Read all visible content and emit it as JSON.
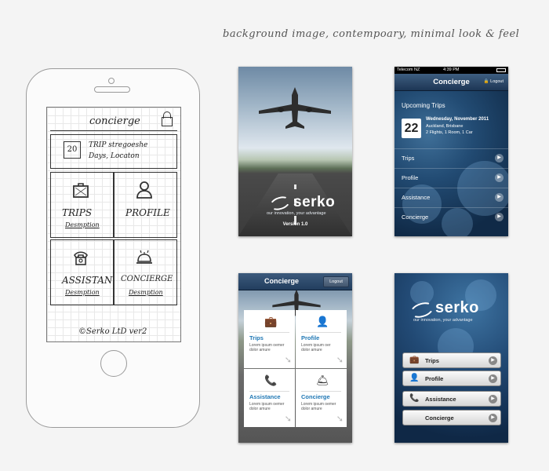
{
  "caption": "background image, contempoary, minimal look & feel",
  "sketch": {
    "title": "concierge",
    "trip_date": "20",
    "trip_line1": "TRIP stregoeshe",
    "trip_line2": "Days, Locaton",
    "tiles": [
      {
        "label": "TRIPS",
        "sub": "Desmption"
      },
      {
        "label": "PROFILE",
        "sub": ""
      },
      {
        "label": "ASSISTAN",
        "sub": "Desmption"
      },
      {
        "label": "CONCIERGE",
        "sub": "Desmption"
      }
    ],
    "footer": "©Serko LtD   ver2"
  },
  "splash": {
    "brand": "serko",
    "tagline": "our innovation, your advantage",
    "version": "Version 1.0"
  },
  "list_screen": {
    "carrier": "Telecom NZ",
    "time": "4:39 PM",
    "title": "Concierge",
    "logout": "Logout",
    "section": "Upcoming Trips",
    "date_day": "22",
    "trip_date": "Wednesday, November 2011",
    "trip_places": "Auckland, Brisbane",
    "trip_items": "2 Flights, 1 Room, 1 Car",
    "rows": [
      "Trips",
      "Profile",
      "Assistance",
      "Concierge"
    ]
  },
  "tiles_screen": {
    "title": "Concierge",
    "logout": "Logout",
    "tiles": [
      {
        "label": "Trips",
        "desc1": "Lorem ipsum oemer",
        "desc2": "dolor amure"
      },
      {
        "label": "Profile",
        "desc1": "Lorem ipsum oer",
        "desc2": "dolor amure"
      },
      {
        "label": "Assistance",
        "desc1": "Lorem ipsum oemer",
        "desc2": "dolor amure"
      },
      {
        "label": "Concierge",
        "desc1": "Lorem ipsum oemer",
        "desc2": "dolor amure"
      }
    ]
  },
  "menu_screen": {
    "brand": "serko",
    "tagline": "our innovation, your advantage",
    "buttons": [
      "Trips",
      "Profile",
      "Assistance",
      "Concierge"
    ]
  },
  "icons": {
    "trips": "suitcase-icon",
    "profile": "person-icon",
    "assistance": "phone-icon",
    "concierge": "bell-icon",
    "row_arrow": "chevron-right-icon",
    "lock": "lock-icon"
  }
}
